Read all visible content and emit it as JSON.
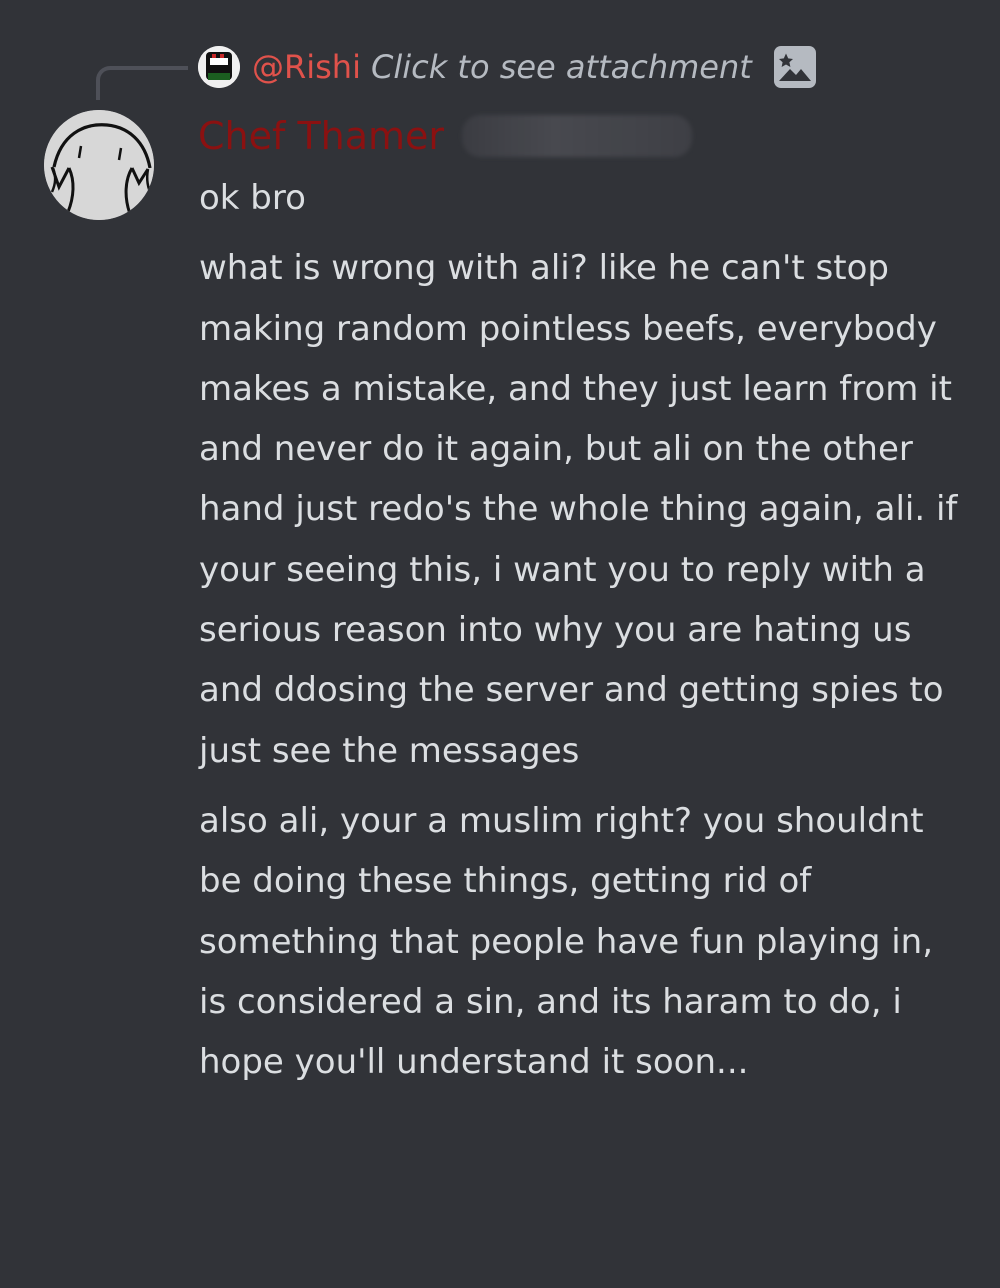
{
  "reply": {
    "username": "@Rishi",
    "preview": "Click to see attachment",
    "attachment_icon": "image-icon"
  },
  "post": {
    "author": "Chef Thamer",
    "messages": [
      "ok bro",
      "what is wrong with ali? like he can't stop making random pointless beefs, everybody makes a mistake, and they just learn from it and never do it again, but ali on the other hand just redo's the whole thing again, ali. if your seeing this, i want you to reply with a serious reason into why you are hating us and ddosing the server and getting spies to just see the messages",
      "also ali, your a muslim right? you shouldnt be doing these things, getting rid of something that people have fun playing in, is considered a sin, and its haram to do, i hope you'll understand it soon..."
    ]
  },
  "colors": {
    "background": "#313338",
    "text": "#dbdee1",
    "reply_username": "#e0524b",
    "author": "#8b1111",
    "muted": "#b5bac1"
  }
}
